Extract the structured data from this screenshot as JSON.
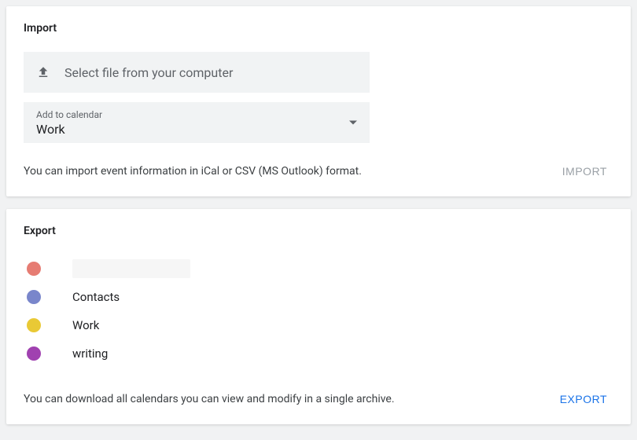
{
  "import": {
    "title": "Import",
    "file_select_label": "Select file from your computer",
    "calendar_select_label": "Add to calendar",
    "calendar_select_value": "Work",
    "helper_text": "You can import event information in iCal or CSV (MS Outlook) format.",
    "action_label": "IMPORT"
  },
  "export": {
    "title": "Export",
    "calendars": [
      {
        "name": "",
        "color": "#e67c73"
      },
      {
        "name": "Contacts",
        "color": "#7986cb"
      },
      {
        "name": "Work",
        "color": "#e9c935"
      },
      {
        "name": "writing",
        "color": "#a041b0"
      }
    ],
    "helper_text": "You can download all calendars you can view and modify in a single archive.",
    "action_label": "EXPORT"
  }
}
